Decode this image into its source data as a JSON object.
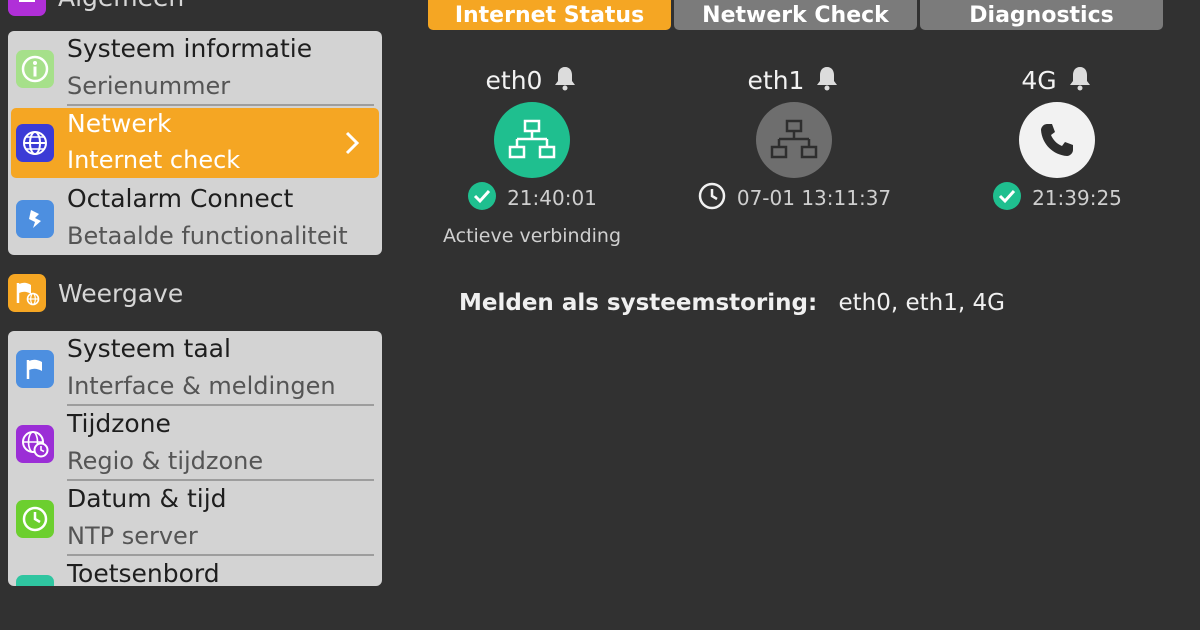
{
  "sidebar": {
    "sections": [
      {
        "label": "Algemeen",
        "icon": "settings-icon",
        "color": "#b02fd8"
      },
      {
        "label": "Weergave",
        "icon": "display-flag-icon",
        "color": "#f5a623"
      }
    ],
    "general_items": [
      {
        "title": "Systeem informatie",
        "subtitle": "Serienummer",
        "icon": "info-icon",
        "color": "#a6e08a"
      },
      {
        "title": "Netwerk",
        "subtitle": "Internet check",
        "icon": "globe-icon",
        "color": "#3b3bd6",
        "active": true
      },
      {
        "title": "Octalarm Connect",
        "subtitle": "Betaalde functionaliteit",
        "icon": "connect-icon",
        "color": "#4d8fe0"
      }
    ],
    "display_items": [
      {
        "title": "Systeem taal",
        "subtitle": "Interface & meldingen",
        "icon": "flag-icon",
        "color": "#4d8fe0"
      },
      {
        "title": "Tijdzone",
        "subtitle": "Regio & tijdzone",
        "icon": "globe-clock-icon",
        "color": "#9b2ed6"
      },
      {
        "title": "Datum & tijd",
        "subtitle": "NTP server",
        "icon": "clock-icon",
        "color": "#6ccf2f"
      },
      {
        "title": "Toetsenbord",
        "subtitle": "",
        "icon": "keyboard-icon",
        "color": "#2fc5a0"
      }
    ]
  },
  "tabs": [
    {
      "label": "Internet Status",
      "active": true
    },
    {
      "label": "Netwerk Check",
      "active": false
    },
    {
      "label": "Diagnostics",
      "active": false
    }
  ],
  "interfaces": [
    {
      "name": "eth0",
      "icon": "network-icon",
      "circle_color": "#1fbf8f",
      "status_icon": "check-icon",
      "time": "21:40:01",
      "note": "Actieve verbinding"
    },
    {
      "name": "eth1",
      "icon": "network-icon",
      "circle_color": "#6e6e6e",
      "status_icon": "clock-icon",
      "time": "07-01 13:11:37",
      "note": ""
    },
    {
      "name": "4G",
      "icon": "phone-icon",
      "circle_color": "#f2f2f2",
      "status_icon": "check-icon",
      "time": "21:39:25",
      "note": ""
    }
  ],
  "report": {
    "label": "Melden als systeemstoring:",
    "value": "eth0, eth1, 4G"
  },
  "colors": {
    "accent": "#f5a623",
    "success": "#1fbf8f",
    "background": "#313131"
  }
}
